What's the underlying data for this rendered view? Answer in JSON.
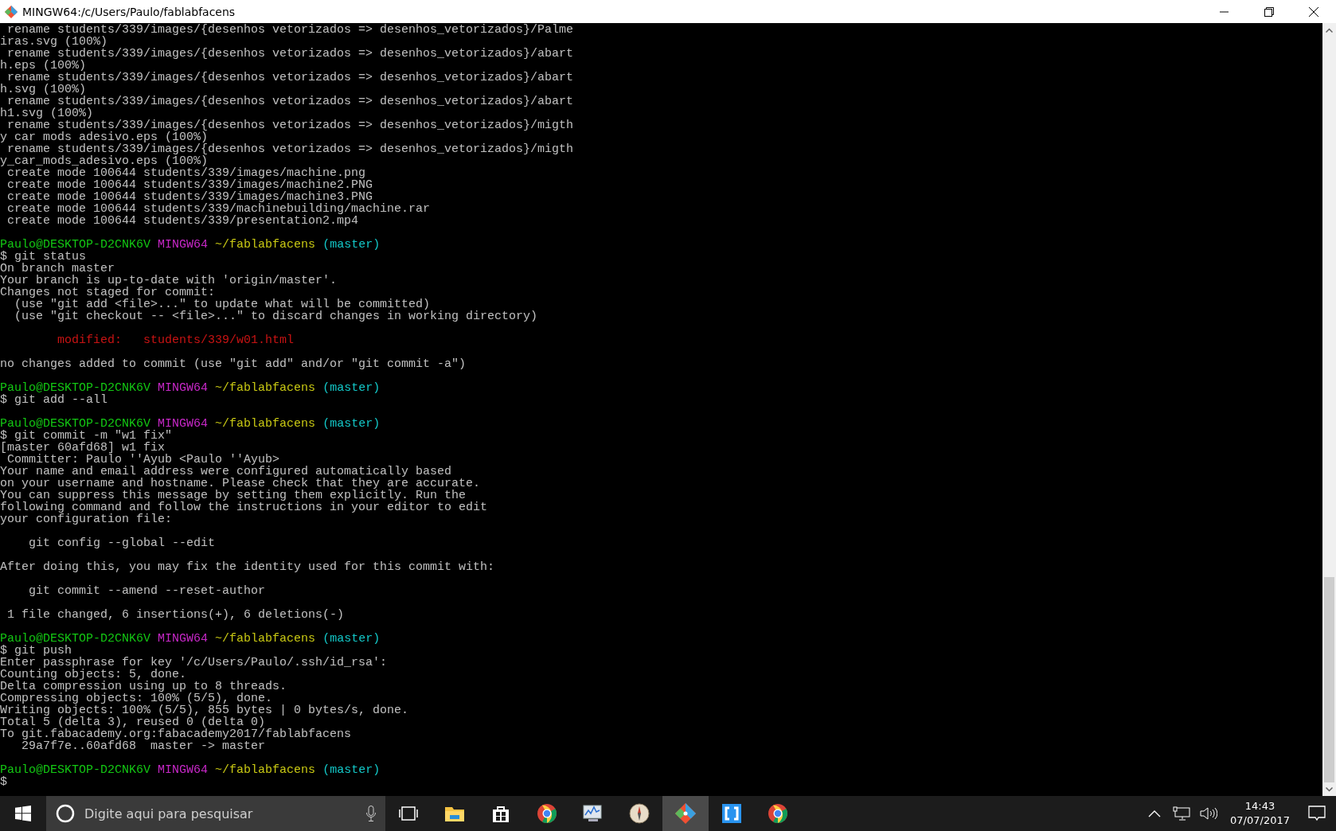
{
  "window": {
    "title": "MINGW64:/c/Users/Paulo/fablabfacens"
  },
  "terminal": {
    "lines": [
      {
        "kind": "text",
        "text": " rename students/339/images/{desenhos vetorizados => desenhos_vetorizados}/Palme"
      },
      {
        "kind": "text",
        "text": "iras.svg (100%)"
      },
      {
        "kind": "text",
        "text": " rename students/339/images/{desenhos vetorizados => desenhos_vetorizados}/abart"
      },
      {
        "kind": "text",
        "text": "h.eps (100%)"
      },
      {
        "kind": "text",
        "text": " rename students/339/images/{desenhos vetorizados => desenhos_vetorizados}/abart"
      },
      {
        "kind": "text",
        "text": "h.svg (100%)"
      },
      {
        "kind": "text",
        "text": " rename students/339/images/{desenhos vetorizados => desenhos_vetorizados}/abart"
      },
      {
        "kind": "text",
        "text": "h1.svg (100%)"
      },
      {
        "kind": "text",
        "text": " rename students/339/images/{desenhos vetorizados => desenhos_vetorizados}/migth"
      },
      {
        "kind": "text",
        "text": "y car mods adesivo.eps (100%)"
      },
      {
        "kind": "text",
        "text": " rename students/339/images/{desenhos vetorizados => desenhos_vetorizados}/migth"
      },
      {
        "kind": "text",
        "text": "y_car_mods_adesivo.eps (100%)"
      },
      {
        "kind": "text",
        "text": " create mode 100644 students/339/images/machine.png"
      },
      {
        "kind": "text",
        "text": " create mode 100644 students/339/images/machine2.PNG"
      },
      {
        "kind": "text",
        "text": " create mode 100644 students/339/images/machine3.PNG"
      },
      {
        "kind": "text",
        "text": " create mode 100644 students/339/machinebuilding/machine.rar"
      },
      {
        "kind": "text",
        "text": " create mode 100644 students/339/presentation2.mp4"
      },
      {
        "kind": "blank"
      },
      {
        "kind": "prompt",
        "user": "Paulo@DESKTOP-D2CNK6V",
        "shell": "MINGW64",
        "path": "~/fablabfacens",
        "branch": "(master)"
      },
      {
        "kind": "text",
        "text": "$ git status"
      },
      {
        "kind": "text",
        "text": "On branch master"
      },
      {
        "kind": "text",
        "text": "Your branch is up-to-date with 'origin/master'."
      },
      {
        "kind": "text",
        "text": "Changes not staged for commit:"
      },
      {
        "kind": "text",
        "text": "  (use \"git add <file>...\" to update what will be committed)"
      },
      {
        "kind": "text",
        "text": "  (use \"git checkout -- <file>...\" to discard changes in working directory)"
      },
      {
        "kind": "blank"
      },
      {
        "kind": "modified",
        "label": "modified:",
        "file": "students/339/w01.html"
      },
      {
        "kind": "blank"
      },
      {
        "kind": "text",
        "text": "no changes added to commit (use \"git add\" and/or \"git commit -a\")"
      },
      {
        "kind": "blank"
      },
      {
        "kind": "prompt",
        "user": "Paulo@DESKTOP-D2CNK6V",
        "shell": "MINGW64",
        "path": "~/fablabfacens",
        "branch": "(master)"
      },
      {
        "kind": "text",
        "text": "$ git add --all"
      },
      {
        "kind": "blank"
      },
      {
        "kind": "prompt",
        "user": "Paulo@DESKTOP-D2CNK6V",
        "shell": "MINGW64",
        "path": "~/fablabfacens",
        "branch": "(master)"
      },
      {
        "kind": "text",
        "text": "$ git commit -m \"w1 fix\""
      },
      {
        "kind": "text",
        "text": "[master 60afd68] w1 fix"
      },
      {
        "kind": "text",
        "text": " Committer: Paulo ''Ayub <Paulo ''Ayub>"
      },
      {
        "kind": "text",
        "text": "Your name and email address were configured automatically based"
      },
      {
        "kind": "text",
        "text": "on your username and hostname. Please check that they are accurate."
      },
      {
        "kind": "text",
        "text": "You can suppress this message by setting them explicitly. Run the"
      },
      {
        "kind": "text",
        "text": "following command and follow the instructions in your editor to edit"
      },
      {
        "kind": "text",
        "text": "your configuration file:"
      },
      {
        "kind": "blank"
      },
      {
        "kind": "text",
        "text": "    git config --global --edit"
      },
      {
        "kind": "blank"
      },
      {
        "kind": "text",
        "text": "After doing this, you may fix the identity used for this commit with:"
      },
      {
        "kind": "blank"
      },
      {
        "kind": "text",
        "text": "    git commit --amend --reset-author"
      },
      {
        "kind": "blank"
      },
      {
        "kind": "text",
        "text": " 1 file changed, 6 insertions(+), 6 deletions(-)"
      },
      {
        "kind": "blank"
      },
      {
        "kind": "prompt",
        "user": "Paulo@DESKTOP-D2CNK6V",
        "shell": "MINGW64",
        "path": "~/fablabfacens",
        "branch": "(master)"
      },
      {
        "kind": "text",
        "text": "$ git push"
      },
      {
        "kind": "text",
        "text": "Enter passphrase for key '/c/Users/Paulo/.ssh/id_rsa':"
      },
      {
        "kind": "text",
        "text": "Counting objects: 5, done."
      },
      {
        "kind": "text",
        "text": "Delta compression using up to 8 threads."
      },
      {
        "kind": "text",
        "text": "Compressing objects: 100% (5/5), done."
      },
      {
        "kind": "text",
        "text": "Writing objects: 100% (5/5), 855 bytes | 0 bytes/s, done."
      },
      {
        "kind": "text",
        "text": "Total 5 (delta 3), reused 0 (delta 0)"
      },
      {
        "kind": "text",
        "text": "To git.fabacademy.org:fabacademy2017/fablabfacens"
      },
      {
        "kind": "text",
        "text": "   29a7f7e..60afd68  master -> master"
      },
      {
        "kind": "blank"
      },
      {
        "kind": "prompt",
        "user": "Paulo@DESKTOP-D2CNK6V",
        "shell": "MINGW64",
        "path": "~/fablabfacens",
        "branch": "(master)"
      },
      {
        "kind": "text",
        "text": "$"
      }
    ]
  },
  "taskbar": {
    "search": {
      "placeholder": "Digite aqui para pesquisar"
    },
    "apps": [
      {
        "kind": "folder",
        "selected": false
      },
      {
        "kind": "store",
        "selected": false
      },
      {
        "kind": "chrome",
        "selected": false
      },
      {
        "kind": "monitor",
        "selected": false
      },
      {
        "kind": "compass",
        "selected": false
      },
      {
        "kind": "git",
        "selected": true
      },
      {
        "kind": "brackets",
        "selected": false
      },
      {
        "kind": "chrome",
        "selected": false
      }
    ],
    "time": "14:43",
    "date": "07/07/2017"
  }
}
